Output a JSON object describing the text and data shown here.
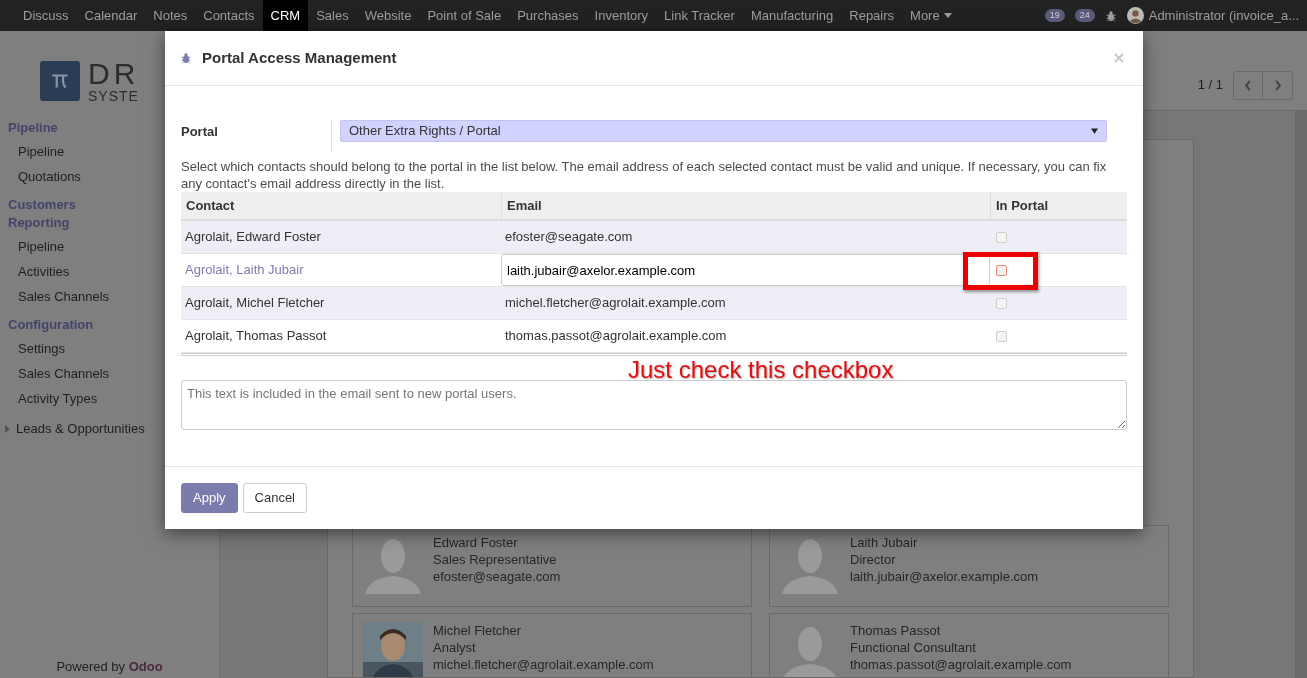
{
  "navbar": {
    "menu": [
      {
        "label": "Discuss",
        "selected": false
      },
      {
        "label": "Calendar",
        "selected": false
      },
      {
        "label": "Notes",
        "selected": false
      },
      {
        "label": "Contacts",
        "selected": false
      },
      {
        "label": "CRM",
        "selected": true
      },
      {
        "label": "Sales",
        "selected": false
      },
      {
        "label": "Website",
        "selected": false
      },
      {
        "label": "Point of Sale",
        "selected": false
      },
      {
        "label": "Purchases",
        "selected": false
      },
      {
        "label": "Inventory",
        "selected": false
      },
      {
        "label": "Link Tracker",
        "selected": false
      },
      {
        "label": "Manufacturing",
        "selected": false
      },
      {
        "label": "Repairs",
        "selected": false
      }
    ],
    "more": "More",
    "activity_count": "19",
    "message_count": "24",
    "user": "Administrator (invoice_a..."
  },
  "logo": {
    "letters": "DR",
    "sub": "SYSTE"
  },
  "sidebar": {
    "sections": [
      {
        "title": "Pipeline",
        "items": [
          "Pipeline",
          "Quotations"
        ]
      },
      {
        "title": "Customers Reporting",
        "items": [
          "Pipeline",
          "Activities",
          "Sales Channels"
        ]
      },
      {
        "title": "Configuration",
        "items": [
          "Settings",
          "Sales Channels",
          "Activity Types"
        ]
      }
    ],
    "collapsible": {
      "label": "Leads & Opportunities",
      "expanded": false
    },
    "footer_prefix": "Powered by",
    "footer_brand": "Odoo"
  },
  "pager": "1 / 1",
  "cards": [
    {
      "name": "Edward Foster",
      "title": "Sales Representative",
      "email": "efoster@seagate.com",
      "kind": "avatar"
    },
    {
      "name": "Laith Jubair",
      "title": "Director",
      "email": "laith.jubair@axelor.example.com",
      "kind": "avatar"
    },
    {
      "name": "Michel Fletcher",
      "title": "Analyst",
      "email": "michel.fletcher@agrolait.example.com",
      "kind": "picture"
    },
    {
      "name": "Thomas Passot",
      "title": "Functional Consultant",
      "email": "thomas.passot@agrolait.example.com",
      "kind": "avatar"
    }
  ],
  "dialog": {
    "title": "Portal Access Management",
    "portal_label": "Portal",
    "portal_value": "Other Extra Rights / Portal",
    "description": "Select which contacts should belong to the portal in the list below. The email address of each selected contact must be valid and unique. If necessary, you can fix any contact's email address directly in the list.",
    "columns": [
      "Contact",
      "Email",
      "In Portal"
    ],
    "rows": [
      {
        "contact": "Agrolait, Edward Foster",
        "email": "efoster@seagate.com",
        "selected": false,
        "in_portal": false
      },
      {
        "contact": "Agrolait, Laith Jubair",
        "email": "laith.jubair@axelor.example.com",
        "selected": true,
        "in_portal": false
      },
      {
        "contact": "Agrolait, Michel Fletcher",
        "email": "michel.fletcher@agrolait.example.com",
        "selected": false,
        "in_portal": false
      },
      {
        "contact": "Agrolait, Thomas Passot",
        "email": "thomas.passot@agrolait.example.com",
        "selected": false,
        "in_portal": false
      }
    ],
    "note_placeholder": "This text is included in the email sent to new portal users.",
    "buttons": [
      {
        "label": "Apply",
        "kind": "primary"
      },
      {
        "label": "Cancel",
        "kind": "secondary"
      }
    ],
    "annotation": "Just check this checkbox"
  }
}
